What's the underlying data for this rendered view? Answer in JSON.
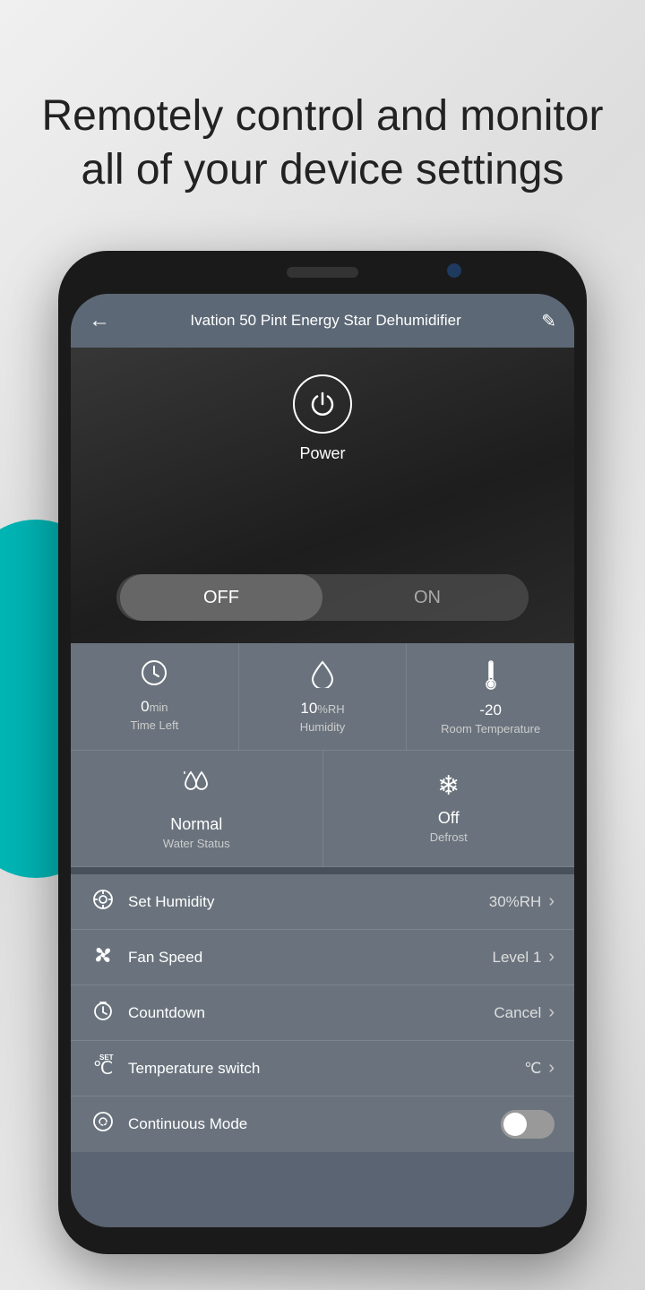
{
  "page": {
    "heading_line1": "Remotely control and monitor",
    "heading_line2": "all of your device settings"
  },
  "app": {
    "title": "Ivation 50 Pint Energy Star Dehumidifier",
    "back_label": "←",
    "edit_icon": "✎",
    "power_label": "Power",
    "toggle_off": "OFF",
    "toggle_on": "ON"
  },
  "stats": [
    {
      "icon": "🕐",
      "value": "0",
      "unit": "min",
      "label": "Time Left"
    },
    {
      "icon": "💧",
      "value": "10",
      "unit": "%RH",
      "label": "Humidity"
    },
    {
      "icon": "🌡",
      "value": "-20",
      "unit": "",
      "label": "Room Temperature"
    }
  ],
  "statuses": [
    {
      "icon": "water_status",
      "value": "Normal",
      "label": "Water Status"
    },
    {
      "icon": "❄",
      "value": "Off",
      "label": "Defrost"
    }
  ],
  "menu_items": [
    {
      "icon": "⚙",
      "label": "Set Humidity",
      "value": "30%RH",
      "type": "chevron"
    },
    {
      "icon": "fan",
      "label": "Fan Speed",
      "value": "Level 1",
      "type": "chevron"
    },
    {
      "icon": "🕐",
      "label": "Countdown",
      "value": "Cancel",
      "type": "chevron"
    },
    {
      "icon": "temp_set",
      "label": "Temperature switch",
      "value": "℃",
      "type": "chevron"
    },
    {
      "icon": "🌐",
      "label": "Continuous Mode",
      "value": "",
      "type": "toggle"
    }
  ],
  "colors": {
    "teal": "#00b5b5",
    "phone_bg": "#1a1a1a",
    "screen_bg": "#6a737d",
    "header_bg": "#5c6875"
  }
}
